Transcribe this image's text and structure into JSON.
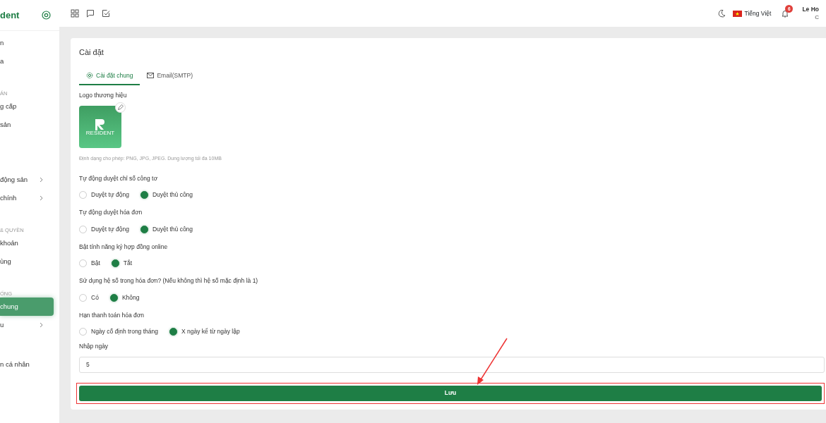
{
  "sidebar": {
    "brand": "dent",
    "sections": [
      {
        "items": [
          {
            "label": "n",
            "chevron": false,
            "selected": false
          },
          {
            "label": "a",
            "chevron": false,
            "selected": false
          }
        ]
      },
      {
        "header": "ÁN",
        "items": [
          {
            "label": "g cấp",
            "chevron": false,
            "selected": false
          },
          {
            "label": "sản",
            "chevron": false,
            "selected": false
          },
          {
            "label": "động sản",
            "chevron": true,
            "selected": false
          },
          {
            "label": "chính",
            "chevron": true,
            "selected": false
          }
        ]
      },
      {
        "header": "& QUYỀN",
        "items": [
          {
            "label": "khoản",
            "chevron": false,
            "selected": false
          },
          {
            "label": "ùng",
            "chevron": false,
            "selected": false
          }
        ]
      },
      {
        "header": "ỐNG",
        "items": [
          {
            "label": "chung",
            "chevron": false,
            "selected": true
          },
          {
            "label": "u",
            "chevron": true,
            "selected": false
          },
          {
            "label": "n cá nhân",
            "chevron": false,
            "selected": false
          }
        ]
      }
    ]
  },
  "topbar": {
    "language": "Tiếng Việt",
    "notification_count": "6",
    "user_name": "Le Ho",
    "user_role": "C"
  },
  "card": {
    "title": "Cài đặt",
    "tabs": [
      {
        "label": "Cài đặt chung",
        "selected": true
      },
      {
        "label": "Email(SMTP)",
        "selected": false
      }
    ],
    "logo_label": "Logo thương hiệu",
    "logo_text": "RESIDENT",
    "logo_hint": "Định dạng cho phép: PNG, JPG, JPEG. Dung lượng tối đa 10MB",
    "radio_groups": [
      {
        "label": "Tự động duyệt chỉ số công tơ",
        "options": [
          {
            "label": "Duyệt tự động",
            "selected": false
          },
          {
            "label": "Duyệt thủ công",
            "selected": true
          }
        ]
      },
      {
        "label": "Tự động duyệt hóa đơn",
        "options": [
          {
            "label": "Duyệt tự động",
            "selected": false
          },
          {
            "label": "Duyệt thủ công",
            "selected": true
          }
        ]
      },
      {
        "label": "Bật tính năng ký hợp đồng online",
        "options": [
          {
            "label": "Bật",
            "selected": false
          },
          {
            "label": "Tắt",
            "selected": true
          }
        ]
      },
      {
        "label": "Sử dụng hệ số trong hóa đơn? (Nếu không thì hệ số mặc định là 1)",
        "options": [
          {
            "label": "Có",
            "selected": false
          },
          {
            "label": "Không",
            "selected": true
          }
        ]
      },
      {
        "label": "Hạn thanh toán hóa đơn",
        "options": [
          {
            "label": "Ngày cố định trong tháng",
            "selected": false
          },
          {
            "label": "X ngày kể từ ngày lập",
            "selected": true
          }
        ]
      }
    ],
    "day_field": {
      "label": "Nhập ngày",
      "value": "5"
    },
    "save_button": "Lưu"
  }
}
